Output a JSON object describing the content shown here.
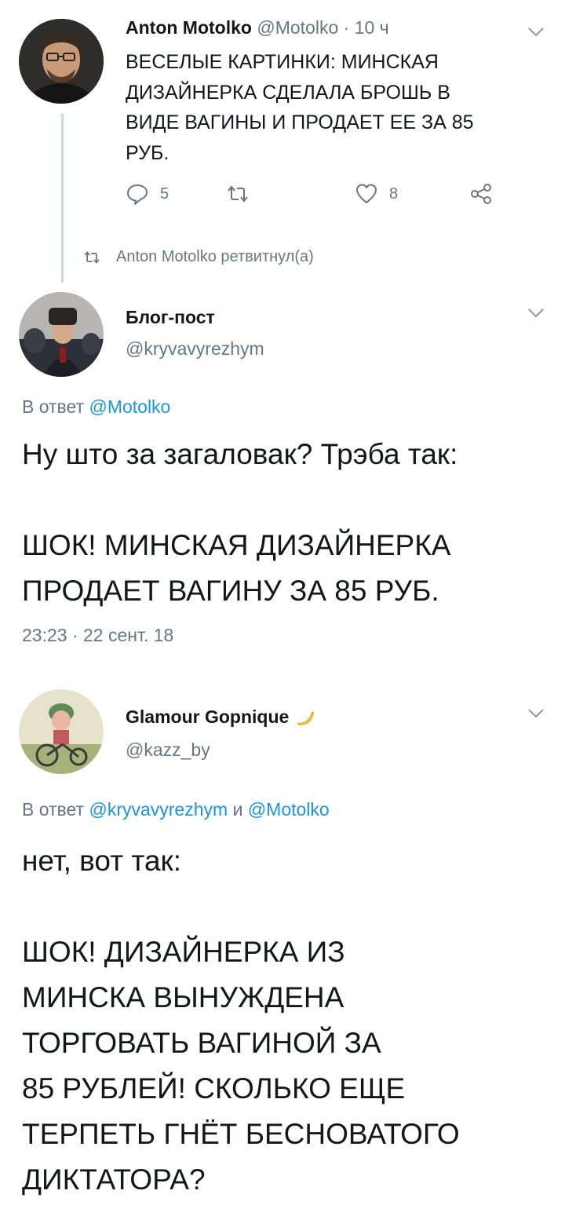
{
  "tweet1": {
    "author_name": "Anton Motolko",
    "author_handle": "@Motolko",
    "separator": "·",
    "time": "10 ч",
    "text": "ВЕСЕЛЫЕ КАРТИНКИ: МИНСКАЯ\nДИЗАЙНЕРКА СДЕЛАЛА БРОШЬ В\nВИДЕ ВАГИНЫ И ПРОДАЕТ ЕЕ ЗА 85\nРУБ.",
    "reply_count": "5",
    "retweet_count": "",
    "like_count": "8",
    "retweeted_by": "Anton Motolko ретвитнул(а)"
  },
  "tweet2": {
    "author_name": "Блог-пост",
    "author_handle": "@kryvavyrezhym",
    "reply_prefix": "В ответ",
    "reply_to": "@Motolko",
    "text": "Ну што за загаловак? Трэба так:\n\nШОК! МИНСКАЯ ДИЗАЙНЕРКА\nПРОДАЕТ ВАГИНУ ЗА 85 РУБ.",
    "timestamp": "23:23 · 22 сент. 18"
  },
  "tweet3": {
    "author_name": "Glamour Gopnique",
    "author_handle": "@kazz_by",
    "reply_prefix": "В ответ",
    "reply_to_1": "@kryvavyrezhym",
    "reply_joiner": "и",
    "reply_to_2": "@Motolko",
    "text": "нет, вот так:\n\nШОК! ДИЗАЙНЕРКА ИЗ\nМИНСКА ВЫНУЖДЕНА\nТОРГОВАТЬ ВАГИНОЙ ЗА\n85 РУБЛЕЙ! СКОЛЬКО ЕЩЕ\nТЕРПЕТЬ ГНЁТ БЕСНОВАТОГО\nДИКТАТОРА?"
  },
  "icons": {
    "reply": "reply-icon",
    "retweet": "retweet-icon",
    "like": "heart-icon",
    "share": "share-icon",
    "menu": "chevron-down-icon",
    "emoji": "banana-emoji"
  },
  "colors": {
    "text": "#14171a",
    "secondary": "#657786",
    "link": "#1b95e0",
    "thread_line": "#ccd6dd"
  }
}
